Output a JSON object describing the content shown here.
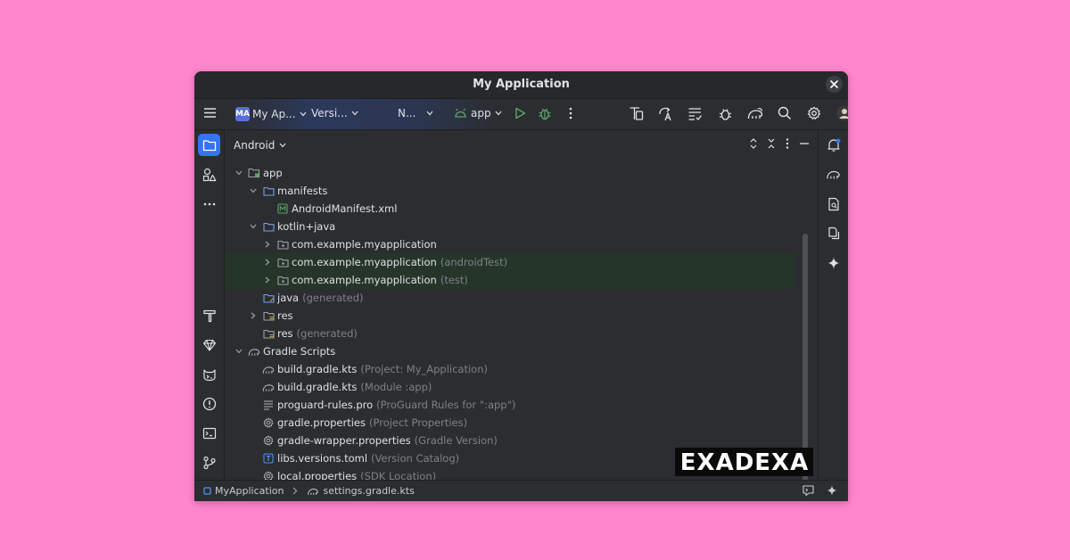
{
  "window": {
    "title": "My Application"
  },
  "toolbar": {
    "project_badge": "MA",
    "project_name": "My Ap...",
    "vcs_label": "Versi...",
    "nav_label": "N...",
    "run_config": "app"
  },
  "panel": {
    "view_mode": "Android"
  },
  "tree": [
    {
      "label": "app",
      "sub": "",
      "depth": 0,
      "arrow": "down",
      "icon": "module-folder-icon",
      "highlight": false
    },
    {
      "label": "manifests",
      "sub": "",
      "depth": 1,
      "arrow": "down",
      "icon": "folder-icon",
      "highlight": false
    },
    {
      "label": "AndroidManifest.xml",
      "sub": "",
      "depth": 2,
      "arrow": "none",
      "icon": "manifest-file-icon",
      "highlight": false
    },
    {
      "label": "kotlin+java",
      "sub": "",
      "depth": 1,
      "arrow": "down",
      "icon": "folder-icon",
      "highlight": false
    },
    {
      "label": "com.example.myapplication",
      "sub": "",
      "depth": 2,
      "arrow": "right",
      "icon": "package-icon",
      "highlight": false
    },
    {
      "label": "com.example.myapplication",
      "sub": "(androidTest)",
      "depth": 2,
      "arrow": "right",
      "icon": "package-icon",
      "highlight": true
    },
    {
      "label": "com.example.myapplication",
      "sub": "(test)",
      "depth": 2,
      "arrow": "right",
      "icon": "package-icon",
      "highlight": true
    },
    {
      "label": "java",
      "sub": "(generated)",
      "depth": 1,
      "arrow": "none",
      "icon": "generated-folder-icon",
      "highlight": false
    },
    {
      "label": "res",
      "sub": "",
      "depth": 1,
      "arrow": "right",
      "icon": "res-folder-icon",
      "highlight": false
    },
    {
      "label": "res",
      "sub": "(generated)",
      "depth": 1,
      "arrow": "none",
      "icon": "res-folder-icon",
      "highlight": false
    },
    {
      "label": "Gradle Scripts",
      "sub": "",
      "depth": 0,
      "arrow": "down",
      "icon": "gradle-icon",
      "highlight": false
    },
    {
      "label": "build.gradle.kts",
      "sub": "(Project: My_Application)",
      "depth": 1,
      "arrow": "none",
      "icon": "gradle-icon",
      "highlight": false
    },
    {
      "label": "build.gradle.kts",
      "sub": "(Module :app)",
      "depth": 1,
      "arrow": "none",
      "icon": "gradle-icon",
      "highlight": false
    },
    {
      "label": "proguard-rules.pro",
      "sub": "(ProGuard Rules for \":app\")",
      "depth": 1,
      "arrow": "none",
      "icon": "text-file-icon",
      "highlight": false
    },
    {
      "label": "gradle.properties",
      "sub": "(Project Properties)",
      "depth": 1,
      "arrow": "none",
      "icon": "settings-file-icon",
      "highlight": false
    },
    {
      "label": "gradle-wrapper.properties",
      "sub": "(Gradle Version)",
      "depth": 1,
      "arrow": "none",
      "icon": "settings-file-icon",
      "highlight": false
    },
    {
      "label": "libs.versions.toml",
      "sub": "(Version Catalog)",
      "depth": 1,
      "arrow": "none",
      "icon": "toml-file-icon",
      "highlight": false
    },
    {
      "label": "local.properties",
      "sub": "(SDK Location)",
      "depth": 1,
      "arrow": "none",
      "icon": "settings-file-icon",
      "highlight": false
    }
  ],
  "statusbar": {
    "crumb_project": "MyApplication",
    "crumb_file": "settings.gradle.kts"
  },
  "watermark": {
    "text": "EXADEXA"
  },
  "colors": {
    "background": "#ff85cd",
    "ide_bg": "#2b2d30",
    "accent_blue": "#3574f0",
    "run_green": "#59a869",
    "highlight_row": "#263529"
  }
}
